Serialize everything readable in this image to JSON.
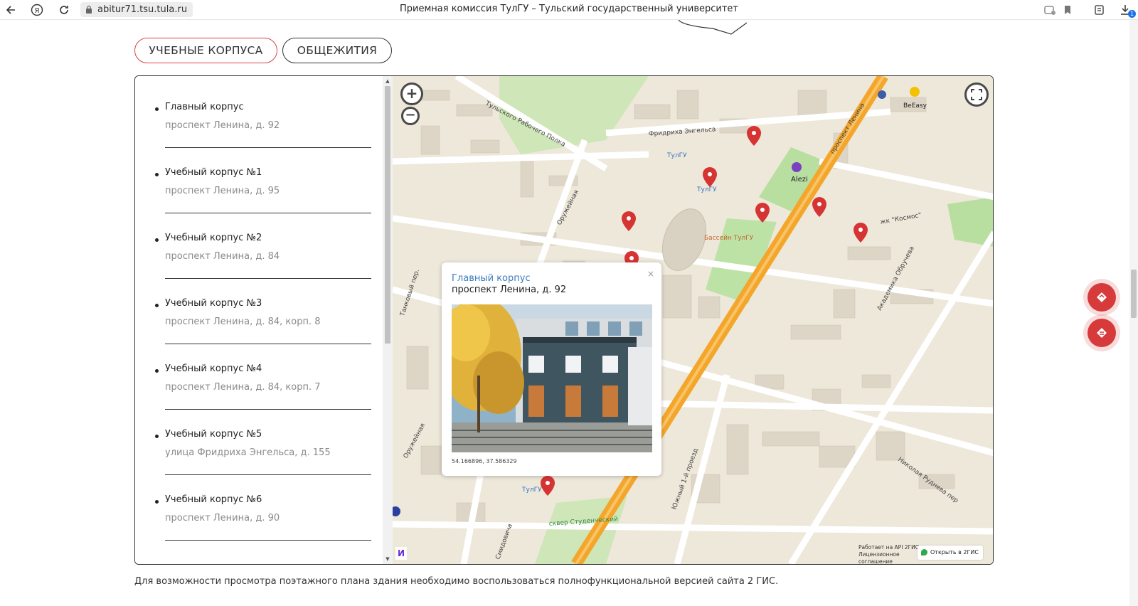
{
  "browser": {
    "url": "abitur71.tsu.tula.ru",
    "title": "Приемная комиссия ТулГУ – Тульский государственный университет",
    "downloads_badge": "1"
  },
  "tabs": [
    {
      "label": "УЧЕБНЫЕ КОРПУСА",
      "active": true
    },
    {
      "label": "ОБЩЕЖИТИЯ",
      "active": false
    }
  ],
  "buildings": [
    {
      "title": "Главный корпус",
      "address": "проспект Ленина, д. 92"
    },
    {
      "title": "Учебный корпус №1",
      "address": "проспект Ленина, д. 95"
    },
    {
      "title": "Учебный корпус №2",
      "address": "проспект Ленина, д. 84"
    },
    {
      "title": "Учебный корпус №3",
      "address": "проспект Ленина, д. 84, корп. 8"
    },
    {
      "title": "Учебный корпус №4",
      "address": "проспект Ленина, д. 84, корп. 7"
    },
    {
      "title": "Учебный корпус №5",
      "address": "улица Фридриха Энгельса, д. 155"
    },
    {
      "title": "Учебный корпус №6",
      "address": "проспект Ленина, д. 90"
    }
  ],
  "map": {
    "street_labels": {
      "tula_rabochego_polka": "Тульского Рабочего Полка",
      "fr_engelsa": "Фридриха Энгельса",
      "lenin_pr": "проспект Ленина",
      "oruzheynaya": "Оружейная",
      "oruzheynaya_2": "Оружейная",
      "tankovy": "Танковый пер.",
      "akad_obrucheva": "Академика Обручева",
      "yuzhny": "Южный 1-й проезд",
      "gudneva": "Николая Руднева пер",
      "smidovicha": "Смидовича",
      "kosmos": "жк \"Космос\"",
      "tulgu_1": "ТулГУ",
      "tulgu_2": "ТулГУ",
      "tulgu_3": "ТулГУ",
      "bassein": "Бассейн ТулГУ",
      "skver": "сквер Студенческий",
      "alezi": "Alezi",
      "beeasy": "BeEasy"
    },
    "popup": {
      "title": "Главный корпус",
      "address": "проспект Ленина, д. 92",
      "coords": "54.166896, 37.586329",
      "close": "×"
    },
    "attribution": "Работает на API 2ГИС Лицензионное соглашение",
    "open_2gis": "Открыть в 2ГИС",
    "yandex": "И"
  },
  "footnote": "Для возможности просмотра поэтажного плана здания необходимо воспользоваться полнофункциональной версией сайта 2 ГИС.",
  "colors": {
    "accent": "#d64545",
    "marker": "#d63333",
    "avenue": "#f4a62a",
    "park": "#b8dea0"
  }
}
